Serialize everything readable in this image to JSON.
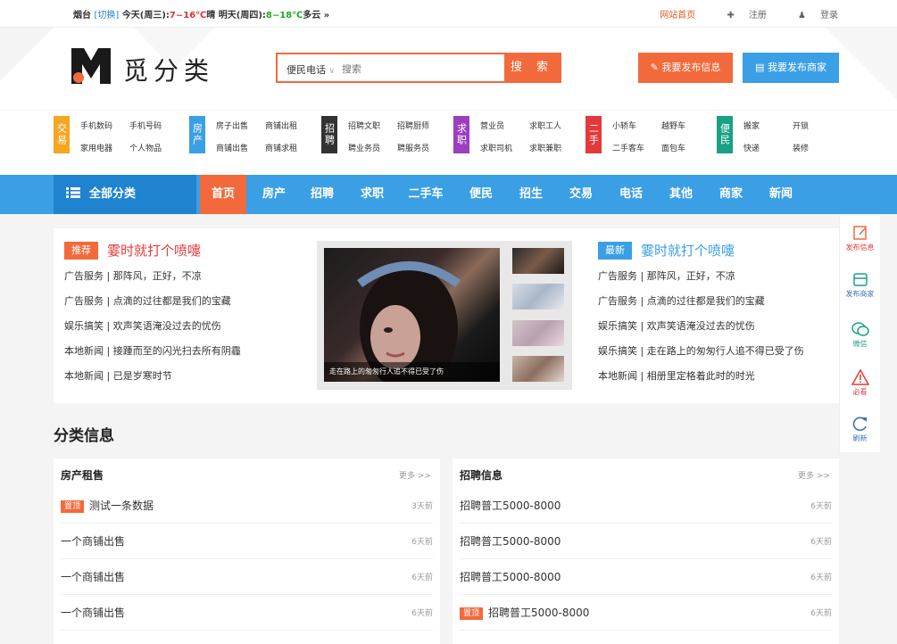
{
  "topbar": {
    "city": "烟台",
    "switch_city": "[切换]",
    "today": "今天(周三):",
    "today_temp": "7~16℃",
    "today_weather": "晴",
    "tomorrow": "明天(周四):",
    "tomorrow_temp": "8~18℃",
    "tomorrow_weather": "多云 »",
    "home_link": "网站首页",
    "register": "注册",
    "login": "登录"
  },
  "header": {
    "logo_text": "觅分类",
    "search_category": "便民电话",
    "search_placeholder": "搜索",
    "search_button": "搜 索",
    "publish_info": "我要发布信息",
    "publish_shop": "我要发布商家"
  },
  "categories": [
    {
      "tag": "交易",
      "color": "#f5a623",
      "links": [
        "手机数码",
        "手机号码",
        "家用电器",
        "个人物品"
      ]
    },
    {
      "tag": "房产",
      "color": "#3b9fe6",
      "links": [
        "房子出售",
        "商铺出租",
        "商铺出售",
        "商铺求租"
      ]
    },
    {
      "tag": "招聘",
      "color": "#333333",
      "links": [
        "招聘文职",
        "招聘厨师",
        "聘业务员",
        "聘服务员"
      ]
    },
    {
      "tag": "求职",
      "color": "#9b3fbf",
      "links": [
        "营业员",
        "求职工人",
        "求职司机",
        "求职兼职"
      ]
    },
    {
      "tag": "二手",
      "color": "#e4393c",
      "links": [
        "小轿车",
        "越野车",
        "二手客车",
        "面包车"
      ]
    },
    {
      "tag": "便民",
      "color": "#1aa083",
      "links": [
        "搬家",
        "开锁",
        "快递",
        "装修"
      ]
    }
  ],
  "nav": {
    "all_categories": "全部分类",
    "items": [
      "首页",
      "房产",
      "招聘",
      "求职",
      "二手车",
      "便民",
      "招生",
      "交易",
      "电话",
      "其他",
      "商家",
      "新闻"
    ]
  },
  "feature": {
    "left": {
      "badge": "推荐",
      "title": "霎时就打个喷嚏",
      "items": [
        "广告服务 | 那阵风，正好，不凉",
        "广告服务 | 点滴的过往都是我们的宝藏",
        "娱乐搞笑 | 欢声笑语淹没过去的忧伤",
        "本地新闻 | 接踵而至的闪光扫去所有阴霾",
        "本地新闻 | 已是岁寒时节"
      ]
    },
    "photo_caption": "走在路上的匆匆行人追不得已受了伤",
    "right": {
      "badge": "最新",
      "title": "霎时就打个喷嚏",
      "items": [
        "广告服务 | 那阵风，正好，不凉",
        "广告服务 | 点滴的过往都是我们的宝藏",
        "娱乐搞笑 | 欢声笑语淹没过去的忧伤",
        "娱乐搞笑 | 走在路上的匆匆行人追不得已受了伤",
        "本地新闻 | 相册里定格着此时的时光"
      ]
    }
  },
  "sidebar": {
    "publish_info": "发布信息",
    "publish_shop": "发布商家",
    "wechat": "微信",
    "must_see": "必看",
    "refresh": "刷新"
  },
  "classified": {
    "title": "分类信息",
    "more": "更多 >>",
    "top_badge": "置顶",
    "left": {
      "title": "房产租售",
      "rows": [
        {
          "text": "测试一条数据",
          "date": "3天前",
          "top": true
        },
        {
          "text": "一个商铺出售",
          "date": "6天前",
          "top": false
        },
        {
          "text": "一个商铺出售",
          "date": "6天前",
          "top": false
        },
        {
          "text": "一个商铺出售",
          "date": "6天前",
          "top": false
        }
      ]
    },
    "right": {
      "title": "招聘信息",
      "rows": [
        {
          "text": "招聘普工5000-8000",
          "date": "6天前",
          "top": false
        },
        {
          "text": "招聘普工5000-8000",
          "date": "6天前",
          "top": false
        },
        {
          "text": "招聘普工5000-8000",
          "date": "6天前",
          "top": false
        },
        {
          "text": "招聘普工5000-8000",
          "date": "6天前",
          "top": true
        }
      ]
    }
  },
  "colors": {
    "accent_orange": "#f26a3b",
    "accent_blue": "#3b9fe6",
    "title_red": "#e4393c"
  }
}
